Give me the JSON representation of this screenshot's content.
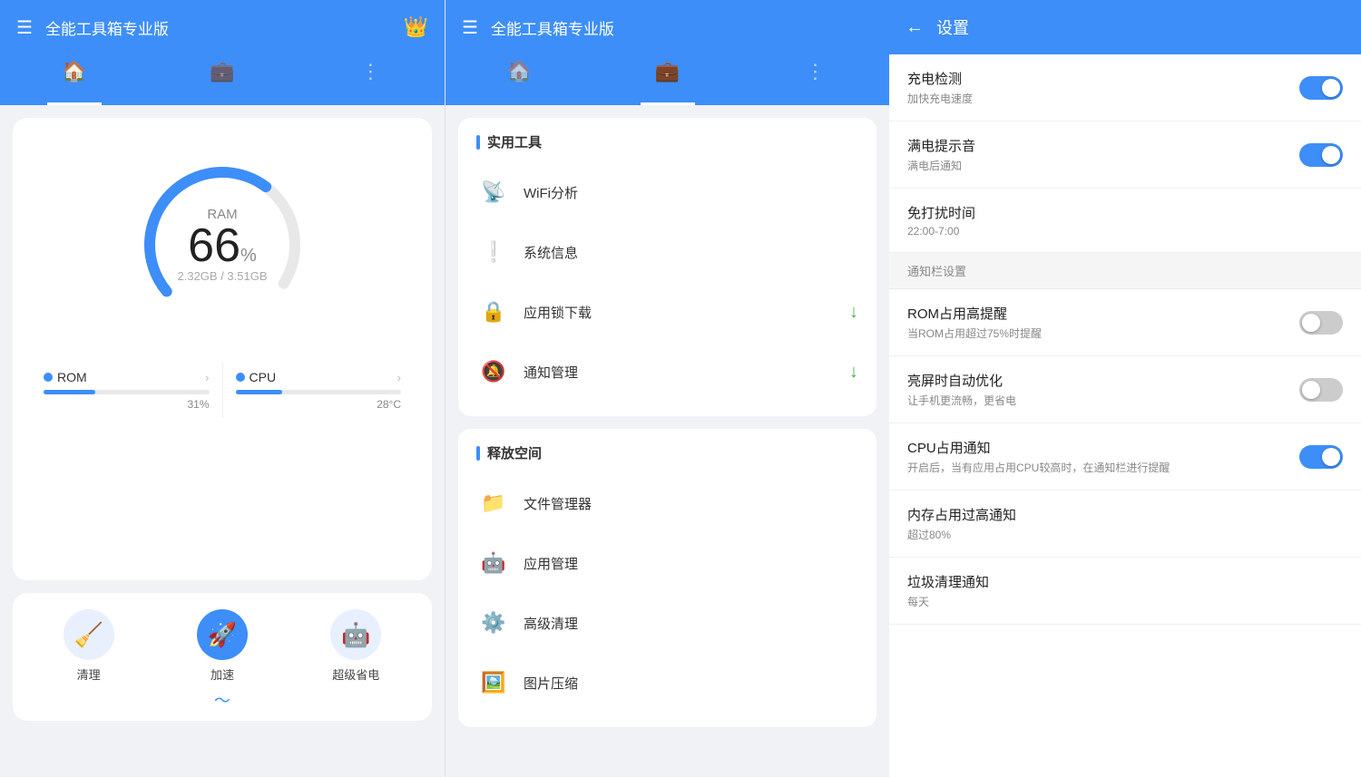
{
  "panel1": {
    "title": "全能工具箱专业版",
    "crown": "👑",
    "tabs": [
      {
        "label": "🏠",
        "active": true
      },
      {
        "label": "💼",
        "active": false
      },
      {
        "label": "⋮",
        "active": false
      }
    ],
    "ram": {
      "label": "RAM",
      "percent": "66",
      "percent_symbol": "%",
      "detail": "2.32GB / 3.51GB",
      "fill": 66
    },
    "stats": [
      {
        "label": "ROM",
        "value": "31%",
        "fill": 31
      },
      {
        "label": "CPU",
        "value": "28°C",
        "fill": 28
      }
    ],
    "actions": [
      {
        "icon": "🧹",
        "label": "清理"
      },
      {
        "icon": "🚀",
        "label": "加速",
        "active": true
      },
      {
        "icon": "🤖",
        "label": "超级省电"
      }
    ],
    "chevron": "〜"
  },
  "panel2": {
    "title": "全能工具箱专业版",
    "tabs": [
      {
        "label": "🏠",
        "active": false
      },
      {
        "label": "💼",
        "active": true
      },
      {
        "label": "⋮",
        "active": false
      }
    ],
    "sections": [
      {
        "title": "实用工具",
        "items": [
          {
            "icon": "📡",
            "text": "WiFi分析",
            "badge": ""
          },
          {
            "icon": "❕",
            "text": "系统信息",
            "badge": ""
          },
          {
            "icon": "🔒",
            "text": "应用锁下载",
            "badge": "↓",
            "badge_color": "green"
          },
          {
            "icon": "🔕",
            "text": "通知管理",
            "badge": "↓",
            "badge_color": "green"
          }
        ]
      },
      {
        "title": "释放空间",
        "items": [
          {
            "icon": "📁",
            "text": "文件管理器",
            "badge": ""
          },
          {
            "icon": "🤖",
            "text": "应用管理",
            "badge": ""
          },
          {
            "icon": "⚙️",
            "text": "高级清理",
            "badge": ""
          },
          {
            "icon": "🖼️",
            "text": "图片压缩",
            "badge": ""
          }
        ]
      }
    ]
  },
  "panel3": {
    "title": "设置",
    "back": "←",
    "items": [
      {
        "type": "setting",
        "label": "充电检测",
        "desc": "加快充电速度",
        "toggle": "on"
      },
      {
        "type": "setting",
        "label": "满电提示音",
        "desc": "满电后通知",
        "toggle": "on"
      },
      {
        "type": "setting",
        "label": "免打扰时间",
        "desc": "22:00-7:00",
        "toggle": null
      },
      {
        "type": "divider",
        "label": "通知栏设置"
      },
      {
        "type": "setting",
        "label": "ROM占用高提醒",
        "desc": "当ROM占用超过75%时提醒",
        "toggle": "off"
      },
      {
        "type": "setting",
        "label": "亮屏时自动优化",
        "desc": "让手机更流畅，更省电",
        "toggle": "off"
      },
      {
        "type": "setting",
        "label": "CPU占用通知",
        "desc": "开启后，当有应用占用CPU较高时，在通知栏进行提醒",
        "toggle": "on"
      },
      {
        "type": "setting",
        "label": "内存占用过高通知",
        "desc": "超过80%",
        "toggle": null
      },
      {
        "type": "setting",
        "label": "垃圾清理通知",
        "desc": "每天",
        "toggle": null
      }
    ]
  }
}
